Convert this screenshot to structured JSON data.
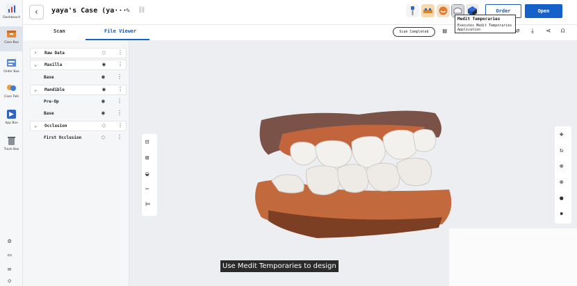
{
  "rail": {
    "items": [
      {
        "label": "Dashboard",
        "icon": "dashboard-chart-icon",
        "active": false
      },
      {
        "label": "Case Box",
        "icon": "case-box-icon",
        "active": true
      },
      {
        "label": "Order Box",
        "icon": "order-box-icon",
        "active": false
      },
      {
        "label": "Case Talk",
        "icon": "case-talk-icon",
        "active": false
      },
      {
        "label": "App Box",
        "icon": "app-box-icon",
        "active": false
      },
      {
        "label": "Trash Box",
        "icon": "trash-icon",
        "active": false
      }
    ],
    "bottom_icons": [
      "settings-gear-icon",
      "message-window-icon",
      "megaphone-icon",
      "help-icon"
    ]
  },
  "header": {
    "case_title": "yaya's Case (ya···",
    "order_label": "Order",
    "open_label": "Open",
    "app_icons": [
      "medit-implant-icon",
      "medit-orthodontic-icon",
      "medit-smile-icon",
      "medit-temporaries-icon",
      "medit-model-icon"
    ]
  },
  "tooltip": {
    "title": "Medit Temporaries",
    "description": "Executes Medit Temporaries Application"
  },
  "tabs": {
    "scan": "Scan",
    "file_viewer": "File Viewer",
    "active": "File Viewer"
  },
  "status": {
    "scan_completed": "Scan Completed"
  },
  "tree": [
    {
      "label": "Raw Data",
      "type": "group",
      "expanded": false,
      "visible": false
    },
    {
      "label": "Maxilla",
      "type": "group",
      "expanded": true,
      "visible": true
    },
    {
      "label": "Base",
      "type": "item",
      "visible": true
    },
    {
      "label": "Mandible",
      "type": "group",
      "expanded": true,
      "visible": true
    },
    {
      "label": "Pre-Op",
      "type": "item",
      "visible": true
    },
    {
      "label": "Base",
      "type": "item",
      "visible": true
    },
    {
      "label": "Occlusion",
      "type": "group",
      "expanded": true,
      "visible": false
    },
    {
      "label": "First Occlusion",
      "type": "item",
      "visible": false
    }
  ],
  "subtitle": "Use Medit Temporaries to design",
  "colors": {
    "primary": "#1560c9",
    "gum": "#c0673f",
    "tooth": "#f1efec"
  }
}
